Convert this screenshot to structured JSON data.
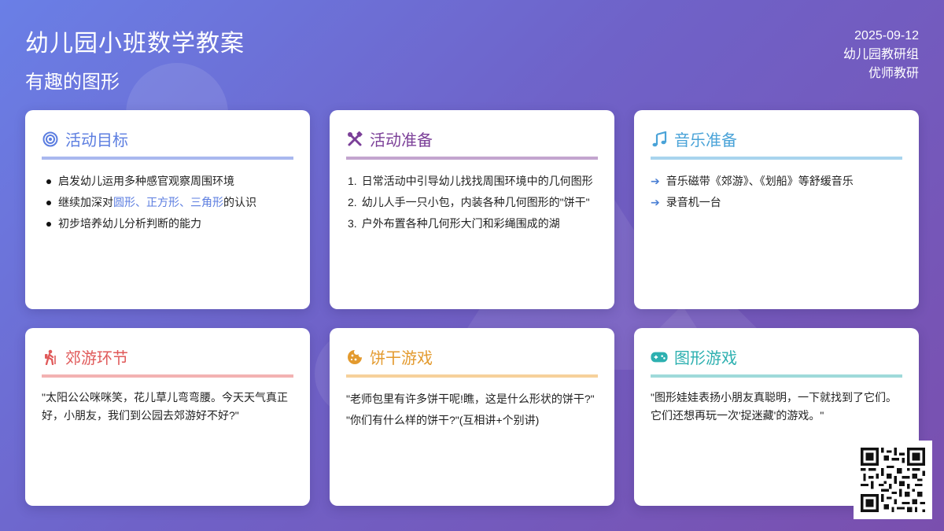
{
  "header": {
    "title": "幼儿园小班数学教案",
    "subtitle": "有趣的图形",
    "date": "2025-09-12",
    "org": "幼儿园教研组",
    "author": "优师教研"
  },
  "colors": {
    "goal": "#5b7de0",
    "prep": "#7b3f98",
    "music": "#4aa3d8",
    "outing": "#e05a5a",
    "biscuit": "#e39a2e",
    "shape_game": "#2db0b0"
  },
  "cards": {
    "goal": {
      "icon": "target-icon",
      "title": "活动目标",
      "items": [
        "启发幼儿运用多种感官观察周围环境"
      ],
      "item2_prefix": "继续加深对",
      "item2_highlight": "圆形、正方形、三角形",
      "item2_suffix": "的认识",
      "item3": "初步培养幼儿分析判断的能力"
    },
    "prep": {
      "icon": "tools-icon",
      "title": "活动准备",
      "items": [
        {
          "num": "1.",
          "text": "日常活动中引导幼儿找找周围环境中的几何图形"
        },
        {
          "num": "2.",
          "text": "幼儿人手一只小包，内装各种几何图形的\"饼干\""
        },
        {
          "num": "3.",
          "text": "户外布置各种几何形大门和彩绳围成的湖"
        }
      ]
    },
    "music": {
      "icon": "music-note-icon",
      "title": "音乐准备",
      "items": [
        "音乐磁带《郊游》、《划船》等舒缓音乐",
        "录音机一台"
      ]
    },
    "outing": {
      "icon": "hiking-icon",
      "title": "郊游环节",
      "text": "\"太阳公公咪咪笑，花儿草儿弯弯腰。今天天气真正好，小朋友，我们到公园去郊游好不好?\""
    },
    "biscuit": {
      "icon": "cookie-icon",
      "title": "饼干游戏",
      "lines": [
        "\"老师包里有许多饼干呢!瞧，这是什么形状的饼干?\"",
        "\"你们有什么样的饼干?\"(互相讲+个别讲)"
      ]
    },
    "shape_game": {
      "icon": "gamepad-icon",
      "title": "图形游戏",
      "text": "\"图形娃娃表扬小朋友真聪明，一下就找到了它们。它们还想再玩一次'捉迷藏'的游戏。\""
    }
  },
  "qr": {
    "icon": "qr-code-icon"
  }
}
